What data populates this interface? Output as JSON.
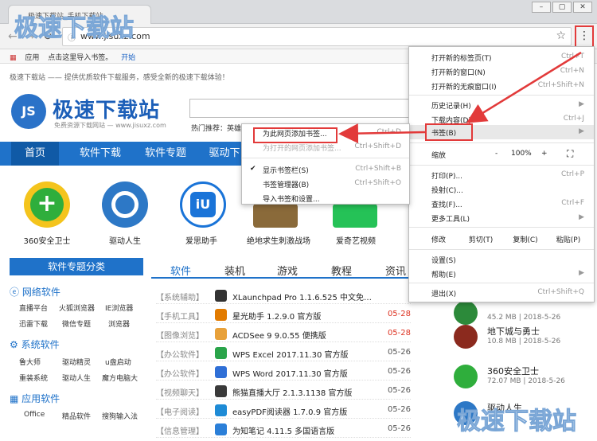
{
  "browser": {
    "tab_title": "极速下载站_手机下载站",
    "url": "www.jisuxz.com",
    "bookmarks_bar": {
      "apps_label": "应用",
      "import_hint": "点击这里导入书签。",
      "start_link": "开始"
    }
  },
  "page": {
    "top_note": "极速下载站 —— 提供优质软件下载服务，感受全新的极速下载体验！",
    "logo_mark": "JS",
    "logo_name": "极速下载站",
    "logo_sub": "免费资源下载网站 — www.jisuxz.com",
    "hot_label": "热门推荐：英雄",
    "nav": [
      "首页",
      "软件下载",
      "软件专题",
      "驱动下"
    ],
    "apps": [
      {
        "label": "360安全卫士",
        "color": "#2fae3c"
      },
      {
        "label": "驱动人生",
        "color": "#2d78c6"
      },
      {
        "label": "爱思助手",
        "color": "#1a74d8"
      },
      {
        "label": "绝地求生刺激战场",
        "color": "#8a6a3a"
      },
      {
        "label": "爱奇艺视频",
        "color": "#25c257"
      }
    ],
    "category_panel": "软件专题分类",
    "categories": [
      {
        "title": "网络软件",
        "links": [
          [
            "直播平台",
            "火狐浏览器",
            "IE浏览器"
          ],
          [
            "迅雷下载",
            "微信专题",
            "浏览器"
          ]
        ]
      },
      {
        "title": "系统软件",
        "links": [
          [
            "鲁大师",
            "驱动精灵",
            "u盘启动"
          ],
          [
            "重装系统",
            "驱动人生",
            "魔方电脑大"
          ]
        ]
      },
      {
        "title": "应用软件",
        "links": [
          [
            "Office",
            "精品软件",
            "搜狗输入法"
          ]
        ]
      }
    ],
    "tabs": [
      "软件",
      "装机",
      "游戏",
      "教程",
      "资讯"
    ],
    "rows": [
      {
        "cat": "【系统辅助】",
        "title": "XLaunchpad Pro 1.1.6.525 中文免…",
        "date": "",
        "color": "#333"
      },
      {
        "cat": "【手机工具】",
        "title": "星光助手 1.2.9.0 官方版",
        "date": "05-28",
        "color": "#e27b00"
      },
      {
        "cat": "【图像浏览】",
        "title": "ACDSee 9 9.0.55 便携版",
        "date": "05-28",
        "color": "#e8a13a"
      },
      {
        "cat": "【办公软件】",
        "title": "WPS Excel 2017.11.30 官方版",
        "date": "05-26",
        "color": "#2aa44a"
      },
      {
        "cat": "【办公软件】",
        "title": "WPS Word 2017.11.30 官方版",
        "date": "05-26",
        "color": "#2f6fd6"
      },
      {
        "cat": "【视频聊天】",
        "title": "熊猫直播大厅 2.1.3.1138 官方版",
        "date": "05-26",
        "color": "#3a3a3a"
      },
      {
        "cat": "【电子阅读】",
        "title": "easyPDF阅读器 1.7.0.9 官方版",
        "date": "05-26",
        "color": "#1e8bd6"
      },
      {
        "cat": "【信息管理】",
        "title": "为知笔记 4.11.5 多国语言版",
        "date": "05-26",
        "color": "#2b7fd8"
      }
    ],
    "right_list": [
      {
        "title": "",
        "meta": "45.2 MB | 2018-5-26",
        "color": "#2c8a3a"
      },
      {
        "title": "地下城与勇士",
        "meta": "10.8 MB | 2018-5-26",
        "color": "#8b2a1e"
      },
      {
        "title": "360安全卫士",
        "meta": "72.07 MB | 2018-5-26",
        "color": "#2fae3c"
      },
      {
        "title": "驱动人生",
        "meta": "",
        "color": "#2d78c6"
      }
    ]
  },
  "chrome_menu": {
    "items": [
      {
        "label": "打开新的标签页(T)",
        "key": "Ctrl+T"
      },
      {
        "label": "打开新的窗口(N)",
        "key": "Ctrl+N"
      },
      {
        "label": "打开新的无痕窗口(I)",
        "key": "Ctrl+Shift+N"
      },
      {
        "label": "历史记录(H)",
        "key": "▶"
      },
      {
        "label": "下载内容(D)",
        "key": "Ctrl+J"
      },
      {
        "label": "书签(B)",
        "key": "▶"
      },
      {
        "label": "缩放",
        "key": ""
      },
      {
        "label": "打印(P)...",
        "key": "Ctrl+P"
      },
      {
        "label": "投射(C)...",
        "key": ""
      },
      {
        "label": "查找(F)...",
        "key": "Ctrl+F"
      },
      {
        "label": "更多工具(L)",
        "key": "▶"
      },
      {
        "label": "修改",
        "key": ""
      },
      {
        "label": "设置(S)",
        "key": ""
      },
      {
        "label": "帮助(E)",
        "key": "▶"
      },
      {
        "label": "退出(X)",
        "key": "Ctrl+Shift+Q"
      }
    ],
    "zoom": {
      "minus": "-",
      "value": "100%",
      "plus": "+",
      "fullscreen": "⛶"
    },
    "edit": {
      "cut": "剪切(T)",
      "copy": "复制(C)",
      "paste": "粘贴(P)"
    }
  },
  "bookmark_submenu": {
    "items": [
      {
        "label": "为此网页添加书签...",
        "key": "Ctrl+D"
      },
      {
        "label": "为打开的网页添加书签...",
        "key": "Ctrl+Shift+D"
      },
      {
        "label": "显示书签栏(S)",
        "key": "Ctrl+Shift+B",
        "checked": "✔"
      },
      {
        "label": "书签管理器(B)",
        "key": "Ctrl+Shift+O"
      },
      {
        "label": "导入书签和设置...",
        "key": ""
      }
    ]
  },
  "watermark": "极速下载站"
}
